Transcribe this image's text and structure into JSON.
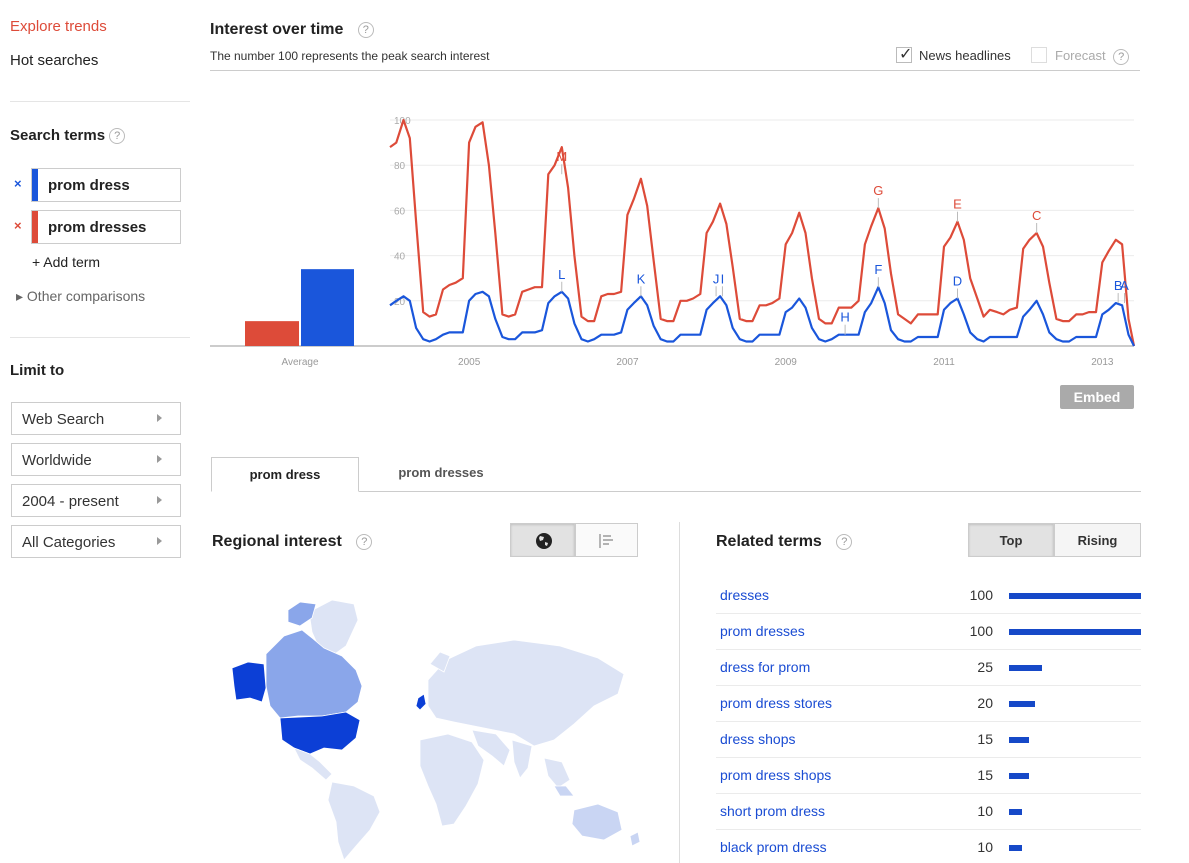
{
  "sidebar": {
    "explore_label": "Explore trends",
    "hot_label": "Hot searches",
    "search_terms_label": "Search terms",
    "terms": [
      {
        "label": "prom dress",
        "color": "#1a56db"
      },
      {
        "label": "prom dresses",
        "color": "#dd4b39"
      }
    ],
    "add_term_label": "+ Add term",
    "other_label": "▸ Other comparisons",
    "limit_label": "Limit to",
    "limits": [
      "Web Search",
      "Worldwide",
      "2004 - present",
      "All Categories"
    ]
  },
  "interest": {
    "title": "Interest over time",
    "subtitle": "The number 100 represents the peak search interest",
    "news_label": "News headlines",
    "forecast_label": "Forecast",
    "embed_label": "Embed"
  },
  "chart_data": {
    "type": "line",
    "title": "Interest over time",
    "ylim": [
      0,
      100
    ],
    "yticks": [
      20,
      40,
      60,
      80,
      100
    ],
    "xlim": [
      2004,
      2013.4
    ],
    "xtick_labels": [
      "2005",
      "2007",
      "2009",
      "2011",
      "2013"
    ],
    "xtick_values": [
      2005,
      2007,
      2009,
      2011,
      2013
    ],
    "average": {
      "label": "Average",
      "values": [
        11,
        34
      ]
    },
    "series": [
      {
        "color": "#dd4b39",
        "points": [
          [
            2004.0,
            88
          ],
          [
            2004.08,
            90
          ],
          [
            2004.17,
            100
          ],
          [
            2004.25,
            92
          ],
          [
            2004.33,
            55
          ],
          [
            2004.42,
            15
          ],
          [
            2004.5,
            13
          ],
          [
            2004.58,
            14
          ],
          [
            2004.67,
            25
          ],
          [
            2004.75,
            27
          ],
          [
            2004.83,
            28
          ],
          [
            2004.92,
            30
          ],
          [
            2005.0,
            90
          ],
          [
            2005.08,
            97
          ],
          [
            2005.17,
            99
          ],
          [
            2005.25,
            80
          ],
          [
            2005.33,
            50
          ],
          [
            2005.42,
            14
          ],
          [
            2005.5,
            13
          ],
          [
            2005.58,
            14
          ],
          [
            2005.67,
            24
          ],
          [
            2005.75,
            25
          ],
          [
            2005.83,
            26
          ],
          [
            2005.92,
            26
          ],
          [
            2006.0,
            76
          ],
          [
            2006.08,
            80
          ],
          [
            2006.17,
            88
          ],
          [
            2006.25,
            70
          ],
          [
            2006.33,
            40
          ],
          [
            2006.42,
            13
          ],
          [
            2006.5,
            11
          ],
          [
            2006.58,
            11
          ],
          [
            2006.67,
            22
          ],
          [
            2006.75,
            23
          ],
          [
            2006.83,
            23
          ],
          [
            2006.92,
            24
          ],
          [
            2007.0,
            58
          ],
          [
            2007.08,
            65
          ],
          [
            2007.17,
            74
          ],
          [
            2007.25,
            62
          ],
          [
            2007.33,
            38
          ],
          [
            2007.42,
            12
          ],
          [
            2007.5,
            11
          ],
          [
            2007.58,
            11
          ],
          [
            2007.67,
            20
          ],
          [
            2007.75,
            20
          ],
          [
            2007.83,
            21
          ],
          [
            2007.92,
            23
          ],
          [
            2008.0,
            50
          ],
          [
            2008.08,
            55
          ],
          [
            2008.17,
            63
          ],
          [
            2008.25,
            54
          ],
          [
            2008.33,
            35
          ],
          [
            2008.42,
            12
          ],
          [
            2008.5,
            11
          ],
          [
            2008.58,
            11
          ],
          [
            2008.67,
            18
          ],
          [
            2008.75,
            18
          ],
          [
            2008.83,
            19
          ],
          [
            2008.92,
            21
          ],
          [
            2009.0,
            45
          ],
          [
            2009.08,
            50
          ],
          [
            2009.17,
            59
          ],
          [
            2009.25,
            50
          ],
          [
            2009.33,
            30
          ],
          [
            2009.42,
            12
          ],
          [
            2009.5,
            10
          ],
          [
            2009.58,
            10
          ],
          [
            2009.67,
            17
          ],
          [
            2009.75,
            17
          ],
          [
            2009.83,
            17
          ],
          [
            2009.92,
            20
          ],
          [
            2010.0,
            45
          ],
          [
            2010.08,
            53
          ],
          [
            2010.17,
            61
          ],
          [
            2010.25,
            52
          ],
          [
            2010.33,
            32
          ],
          [
            2010.42,
            14
          ],
          [
            2010.5,
            12
          ],
          [
            2010.58,
            10
          ],
          [
            2010.67,
            14
          ],
          [
            2010.75,
            14
          ],
          [
            2010.83,
            14
          ],
          [
            2010.92,
            14
          ],
          [
            2011.0,
            44
          ],
          [
            2011.08,
            48
          ],
          [
            2011.17,
            55
          ],
          [
            2011.25,
            47
          ],
          [
            2011.33,
            30
          ],
          [
            2011.42,
            21
          ],
          [
            2011.5,
            13
          ],
          [
            2011.58,
            16
          ],
          [
            2011.67,
            15
          ],
          [
            2011.75,
            14
          ],
          [
            2011.83,
            16
          ],
          [
            2011.92,
            17
          ],
          [
            2012.0,
            43
          ],
          [
            2012.08,
            47
          ],
          [
            2012.17,
            50
          ],
          [
            2012.25,
            44
          ],
          [
            2012.33,
            28
          ],
          [
            2012.42,
            12
          ],
          [
            2012.5,
            11
          ],
          [
            2012.58,
            11
          ],
          [
            2012.67,
            14
          ],
          [
            2012.75,
            14
          ],
          [
            2012.83,
            15
          ],
          [
            2012.92,
            15
          ],
          [
            2013.0,
            37
          ],
          [
            2013.08,
            42
          ],
          [
            2013.17,
            47
          ],
          [
            2013.25,
            45
          ],
          [
            2013.33,
            12
          ],
          [
            2013.4,
            0
          ]
        ]
      },
      {
        "color": "#1a56db",
        "points": [
          [
            2004.0,
            18
          ],
          [
            2004.08,
            20
          ],
          [
            2004.17,
            22
          ],
          [
            2004.25,
            20
          ],
          [
            2004.33,
            8
          ],
          [
            2004.42,
            3
          ],
          [
            2004.5,
            2
          ],
          [
            2004.58,
            3
          ],
          [
            2004.67,
            5
          ],
          [
            2004.75,
            6
          ],
          [
            2004.83,
            6
          ],
          [
            2004.92,
            6
          ],
          [
            2005.0,
            20
          ],
          [
            2005.08,
            23
          ],
          [
            2005.17,
            24
          ],
          [
            2005.25,
            22
          ],
          [
            2005.33,
            12
          ],
          [
            2005.42,
            4
          ],
          [
            2005.5,
            3
          ],
          [
            2005.58,
            3
          ],
          [
            2005.67,
            6
          ],
          [
            2005.75,
            6
          ],
          [
            2005.83,
            6
          ],
          [
            2005.92,
            7
          ],
          [
            2006.0,
            19
          ],
          [
            2006.08,
            22
          ],
          [
            2006.17,
            24
          ],
          [
            2006.25,
            21
          ],
          [
            2006.33,
            10
          ],
          [
            2006.42,
            3
          ],
          [
            2006.5,
            2
          ],
          [
            2006.58,
            3
          ],
          [
            2006.67,
            5
          ],
          [
            2006.75,
            5
          ],
          [
            2006.83,
            5
          ],
          [
            2006.92,
            6
          ],
          [
            2007.0,
            16
          ],
          [
            2007.08,
            19
          ],
          [
            2007.17,
            22
          ],
          [
            2007.25,
            18
          ],
          [
            2007.33,
            9
          ],
          [
            2007.42,
            3
          ],
          [
            2007.5,
            2
          ],
          [
            2007.58,
            2
          ],
          [
            2007.67,
            5
          ],
          [
            2007.75,
            5
          ],
          [
            2007.83,
            5
          ],
          [
            2007.92,
            5
          ],
          [
            2008.0,
            16
          ],
          [
            2008.08,
            19
          ],
          [
            2008.17,
            22
          ],
          [
            2008.25,
            18
          ],
          [
            2008.33,
            8
          ],
          [
            2008.42,
            3
          ],
          [
            2008.5,
            2
          ],
          [
            2008.58,
            2
          ],
          [
            2008.67,
            5
          ],
          [
            2008.75,
            5
          ],
          [
            2008.83,
            5
          ],
          [
            2008.92,
            5
          ],
          [
            2009.0,
            15
          ],
          [
            2009.08,
            17
          ],
          [
            2009.17,
            21
          ],
          [
            2009.25,
            17
          ],
          [
            2009.33,
            8
          ],
          [
            2009.42,
            3
          ],
          [
            2009.5,
            2
          ],
          [
            2009.58,
            3
          ],
          [
            2009.67,
            5
          ],
          [
            2009.75,
            5
          ],
          [
            2009.83,
            5
          ],
          [
            2009.92,
            5
          ],
          [
            2010.0,
            15
          ],
          [
            2010.08,
            19
          ],
          [
            2010.17,
            26
          ],
          [
            2010.25,
            19
          ],
          [
            2010.33,
            7
          ],
          [
            2010.42,
            3
          ],
          [
            2010.5,
            2
          ],
          [
            2010.58,
            2
          ],
          [
            2010.67,
            4
          ],
          [
            2010.75,
            4
          ],
          [
            2010.83,
            4
          ],
          [
            2010.92,
            4
          ],
          [
            2011.0,
            16
          ],
          [
            2011.08,
            19
          ],
          [
            2011.17,
            21
          ],
          [
            2011.25,
            14
          ],
          [
            2011.33,
            6
          ],
          [
            2011.42,
            3
          ],
          [
            2011.5,
            2
          ],
          [
            2011.58,
            4
          ],
          [
            2011.67,
            4
          ],
          [
            2011.75,
            4
          ],
          [
            2011.83,
            4
          ],
          [
            2011.92,
            4
          ],
          [
            2012.0,
            13
          ],
          [
            2012.08,
            16
          ],
          [
            2012.17,
            20
          ],
          [
            2012.25,
            14
          ],
          [
            2012.33,
            6
          ],
          [
            2012.42,
            3
          ],
          [
            2012.5,
            2
          ],
          [
            2012.58,
            2
          ],
          [
            2012.67,
            4
          ],
          [
            2012.75,
            4
          ],
          [
            2012.83,
            4
          ],
          [
            2012.92,
            4
          ],
          [
            2013.0,
            14
          ],
          [
            2013.08,
            16
          ],
          [
            2013.17,
            19
          ],
          [
            2013.25,
            18
          ],
          [
            2013.33,
            5
          ],
          [
            2013.4,
            0
          ]
        ]
      }
    ],
    "annotations": [
      {
        "label": "M",
        "x": 2006.17,
        "y": 76,
        "color": "#dd4b39"
      },
      {
        "label": "G",
        "x": 2010.17,
        "y": 61,
        "color": "#dd4b39"
      },
      {
        "label": "E",
        "x": 2011.17,
        "y": 55,
        "color": "#dd4b39"
      },
      {
        "label": "C",
        "x": 2012.17,
        "y": 50,
        "color": "#dd4b39"
      },
      {
        "label": "L",
        "x": 2006.17,
        "y": 24,
        "color": "#1a56db"
      },
      {
        "label": "K",
        "x": 2007.17,
        "y": 22,
        "color": "#1a56db"
      },
      {
        "label": "J",
        "x": 2008.12,
        "y": 22,
        "color": "#1a56db"
      },
      {
        "label": "I",
        "x": 2008.2,
        "y": 22,
        "color": "#1a56db"
      },
      {
        "label": "H",
        "x": 2009.75,
        "y": 5,
        "color": "#1a56db"
      },
      {
        "label": "F",
        "x": 2010.17,
        "y": 26,
        "color": "#1a56db"
      },
      {
        "label": "D",
        "x": 2011.17,
        "y": 21,
        "color": "#1a56db"
      },
      {
        "label": "B",
        "x": 2013.2,
        "y": 19,
        "color": "#1a56db"
      },
      {
        "label": "A",
        "x": 2013.28,
        "y": 19,
        "color": "#1a56db"
      }
    ]
  },
  "tabs": [
    {
      "label": "prom dress",
      "active": true
    },
    {
      "label": "prom dresses",
      "active": false
    }
  ],
  "regional": {
    "title": "Regional interest",
    "view_icons": [
      "globe-icon",
      "list-icon"
    ]
  },
  "related": {
    "title": "Related terms",
    "top_label": "Top",
    "rising_label": "Rising",
    "items": [
      {
        "name": "dresses",
        "value": 100
      },
      {
        "name": "prom dresses",
        "value": 100
      },
      {
        "name": "dress for prom",
        "value": 25
      },
      {
        "name": "prom dress stores",
        "value": 20
      },
      {
        "name": "dress shops",
        "value": 15
      },
      {
        "name": "prom dress shops",
        "value": 15
      },
      {
        "name": "short prom dress",
        "value": 10
      },
      {
        "name": "black prom dress",
        "value": 10
      }
    ]
  }
}
